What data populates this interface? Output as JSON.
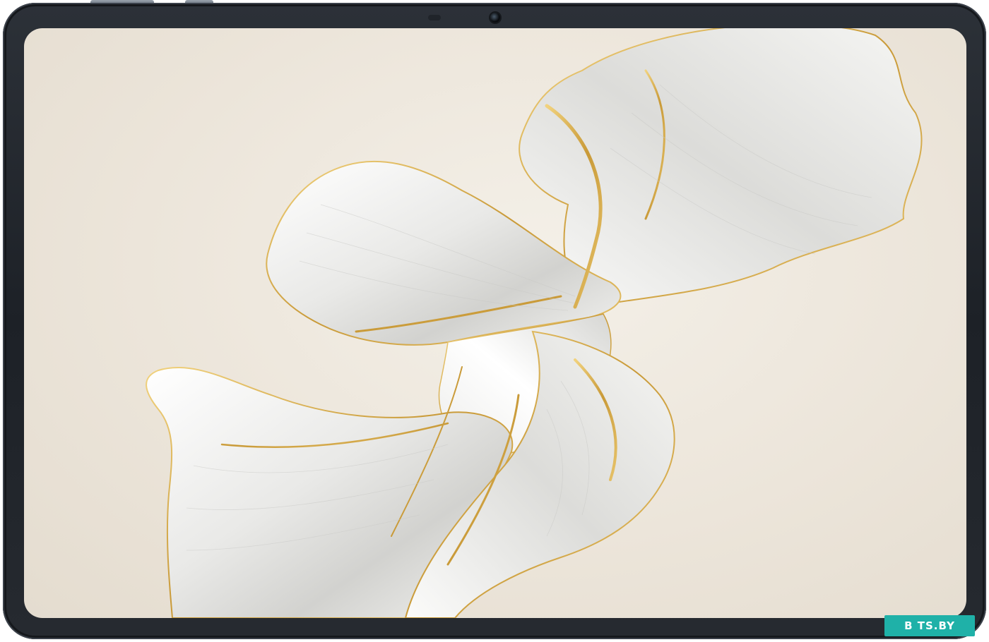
{
  "device": {
    "type": "tablet",
    "orientation": "landscape",
    "bezel_color": "#23272d",
    "screen_background": "#ece5da"
  },
  "wallpaper": {
    "subject": "abstract-flowing-petal",
    "colors": {
      "petal": "#f5f5f3",
      "shadow": "#c9c9c6",
      "accent": "#d4a94c"
    }
  },
  "watermark": {
    "text": "B TS.BY",
    "background": "#1fb1a8"
  }
}
